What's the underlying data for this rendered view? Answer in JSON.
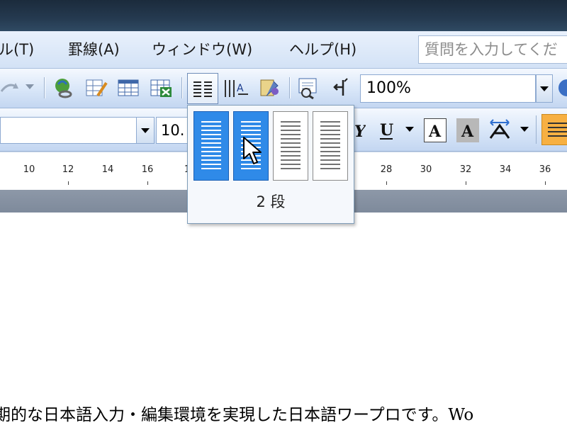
{
  "menu": {
    "items": [
      {
        "label": "ル(T)"
      },
      {
        "label": "罫線(A)"
      },
      {
        "label": "ウィンドウ(W)"
      },
      {
        "label": "ヘルプ(H)"
      }
    ],
    "question_placeholder": "質問を入力してくだ"
  },
  "toolbar1": {
    "zoom_value": "100%"
  },
  "toolbar2": {
    "font_size": "10."
  },
  "ruler": {
    "labels": [
      "10",
      "12",
      "14",
      "16",
      "1",
      "28",
      "30",
      "32",
      "34",
      "36"
    ]
  },
  "columns_popup": {
    "options": [
      {
        "columns": 1,
        "selected": true
      },
      {
        "columns": 2,
        "selected": true
      },
      {
        "columns": 3,
        "selected": false
      },
      {
        "columns": 4,
        "selected": false
      }
    ],
    "label": "2 段"
  },
  "document": {
    "visible_line": "期的な日本語入力・編集環境を実現した日本語ワープロです。Wo"
  },
  "colors": {
    "accent_selected": "#2f8ae8",
    "toolbar_bg": "#d8e6f8",
    "highlight_orange": "#f7b042"
  }
}
